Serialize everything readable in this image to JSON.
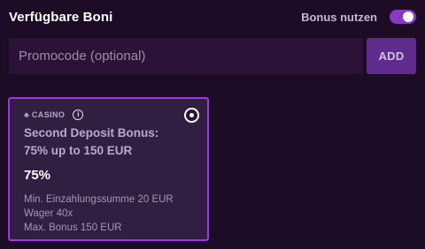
{
  "header": {
    "title": "Verfügbare Boni",
    "toggle_label": "Bonus nutzen",
    "toggle_on": true
  },
  "promo": {
    "placeholder": "Promocode (optional)",
    "value": "",
    "add_label": "ADD"
  },
  "bonus": {
    "category_icon": "casino-icon",
    "category": "CASINO",
    "title_line1": "Second Deposit Bonus:",
    "title_line2": "75% up to 150 EUR",
    "percent": "75%",
    "details": [
      "Min. Einzahlungssumme 20 EUR",
      "Wager 40x",
      "Max. Bonus 150 EUR"
    ],
    "selected": true
  },
  "colors": {
    "background": "#1c0c26",
    "accent": "#9b37e6",
    "toggle": "#8a36c7",
    "button": "#5f2b8c",
    "card": "#321e41"
  }
}
